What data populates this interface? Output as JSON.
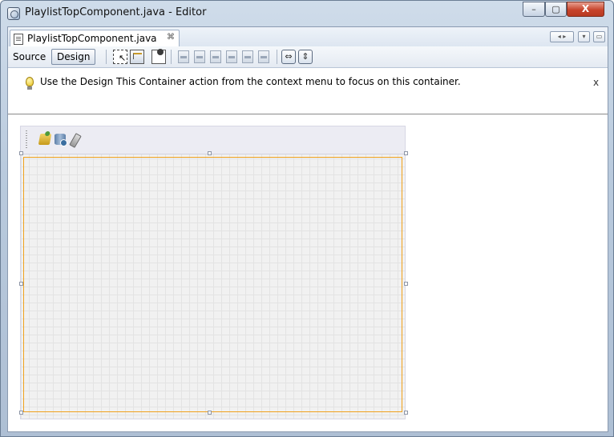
{
  "window": {
    "title": "PlaylistTopComponent.java - Editor",
    "app_icon": "netbeans-cube-icon",
    "controls": {
      "minimize": "–",
      "maximize": "▢",
      "close": "X"
    }
  },
  "tabs": {
    "active_label": "PlaylistTopComponent.java",
    "close_glyph": "⌘"
  },
  "tab_nav": {
    "arrows": "◂ ▸",
    "dropdown": "▾",
    "maximize": "▭"
  },
  "toolbar": {
    "source_label": "Source",
    "design_label": "Design",
    "icons": [
      "selection-mode-icon",
      "connection-mode-icon",
      "preview-design-icon",
      "align-left-icon",
      "align-right-icon",
      "center-horizontal-icon",
      "align-top-icon",
      "align-bottom-icon",
      "center-vertical-icon",
      "change-horizontal-resizability-icon",
      "change-vertical-resizability-icon"
    ],
    "resize_h_glyph": "⇔",
    "resize_v_glyph": "⇕"
  },
  "info_bar": {
    "message": "Use the Design This Container action from the context menu to focus on this container.",
    "close_label": "x"
  },
  "form": {
    "toolbar_icons": [
      "open-folder-icon",
      "database-icon",
      "edit-pencil-icon"
    ]
  }
}
